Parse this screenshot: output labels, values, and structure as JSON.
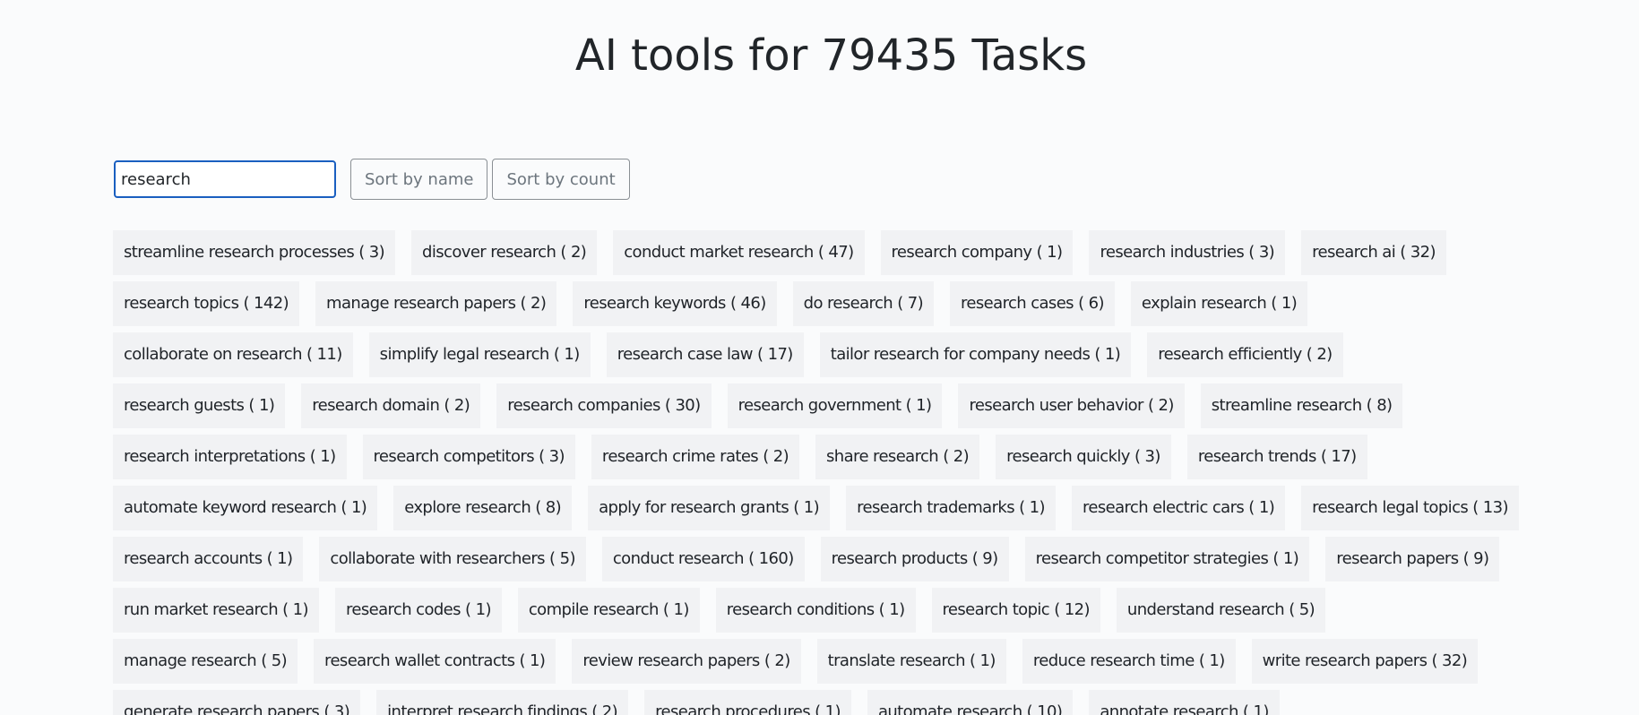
{
  "header": {
    "title": "AI tools for 79435 Tasks"
  },
  "controls": {
    "search_value": "research",
    "sort_by_name": "Sort by name",
    "sort_by_count": "Sort by count"
  },
  "tags": [
    [
      "streamline research processes ( 3)",
      "discover research ( 2)",
      "conduct market research ( 47)",
      "research company ( 1)",
      "research industries ( 3)",
      "research ai ( 32)"
    ],
    [
      "research topics ( 142)",
      "manage research papers ( 2)",
      "research keywords ( 46)",
      "do research ( 7)",
      "research cases ( 6)",
      "explain research ( 1)"
    ],
    [
      "collaborate on research ( 11)",
      "simplify legal research ( 1)",
      "research case law ( 17)",
      "tailor research for company needs ( 1)",
      "research efficiently ( 2)"
    ],
    [
      "research guests ( 1)",
      "research domain ( 2)",
      "research companies ( 30)",
      "research government ( 1)",
      "research user behavior ( 2)",
      "streamline research ( 8)"
    ],
    [
      "research interpretations ( 1)",
      "research competitors ( 3)",
      "research crime rates ( 2)",
      "share research ( 2)",
      "research quickly ( 3)",
      "research trends ( 17)"
    ],
    [
      "automate keyword research ( 1)",
      "explore research ( 8)",
      "apply for research grants ( 1)",
      "research trademarks ( 1)",
      "research electric cars ( 1)",
      "research legal topics ( 13)"
    ],
    [
      "research accounts ( 1)",
      "collaborate with researchers ( 5)",
      "conduct research ( 160)",
      "research products ( 9)",
      "research competitor strategies ( 1)",
      "research papers ( 9)"
    ],
    [
      "run market research ( 1)",
      "research codes ( 1)",
      "compile research ( 1)",
      "research conditions ( 1)",
      "research topic ( 12)",
      "understand research ( 5)"
    ],
    [
      "manage research ( 5)",
      "research wallet contracts ( 1)",
      "review research papers ( 2)",
      "translate research ( 1)",
      "reduce research time ( 1)",
      "write research papers ( 32)"
    ],
    [
      "generate research papers ( 3)",
      "interpret research findings ( 2)",
      "research procedures ( 1)",
      "automate research ( 10)",
      "annotate research ( 1)"
    ]
  ]
}
